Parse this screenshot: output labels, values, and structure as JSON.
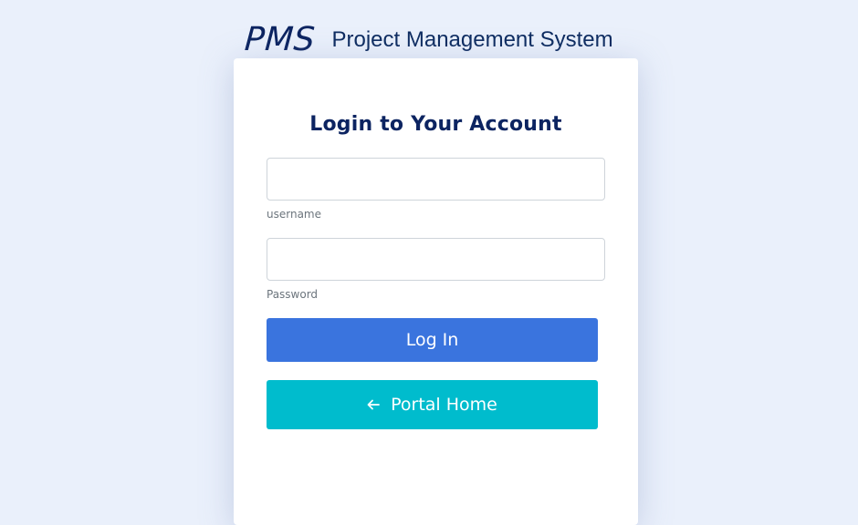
{
  "brand": {
    "logo": "PMS",
    "subtitle": "Project Management System"
  },
  "login": {
    "title": "Login to Your Account",
    "username_label": "username",
    "username_value": "",
    "password_label": "Password",
    "password_value": "",
    "login_button": "Log In",
    "portal_button": "Portal Home",
    "portal_icon": "arrow-left-icon"
  },
  "colors": {
    "background": "#eaf0fb",
    "brand_navy": "#0c2461",
    "login_button": "#3a74de",
    "portal_button": "#00bccd"
  }
}
